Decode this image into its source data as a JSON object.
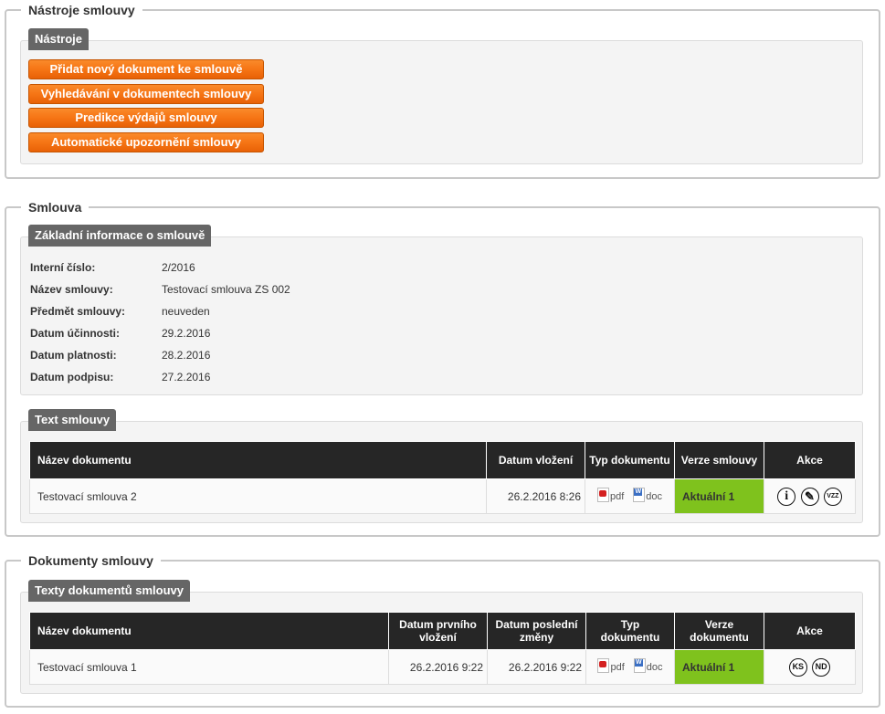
{
  "tools": {
    "legend": "Nástroje smlouvy",
    "panel_title": "Nástroje",
    "buttons": [
      "Přidat nový dokument ke smlouvě",
      "Vyhledávání v dokumentech smlouvy",
      "Predikce výdajů smlouvy",
      "Automatické upozornění smlouvy"
    ]
  },
  "contract": {
    "legend": "Smlouva",
    "basic_title": "Základní informace o smlouvě",
    "fields": [
      {
        "label": "Interní číslo:",
        "value": "2/2016"
      },
      {
        "label": "Název smlouvy:",
        "value": "Testovací smlouva ZS 002"
      },
      {
        "label": "Předmět smlouvy:",
        "value": "neuveden"
      },
      {
        "label": "Datum účinnosti:",
        "value": "29.2.2016"
      },
      {
        "label": "Datum platnosti:",
        "value": "28.2.2016"
      },
      {
        "label": "Datum podpisu:",
        "value": "27.2.2016"
      }
    ],
    "text_title": "Text smlouvy",
    "columns": {
      "name": "Název dokumentu",
      "date": "Datum vložení",
      "type": "Typ dokumentu",
      "version": "Verze smlouvy",
      "actions": "Akce"
    },
    "rows": [
      {
        "name": "Testovací smlouva 2",
        "date": "26.2.2016 8:26",
        "pdf": "pdf",
        "doc": "doc",
        "version": "Aktuální 1",
        "actions": [
          "i",
          "✎",
          "VZZ"
        ]
      }
    ]
  },
  "documents": {
    "legend": "Dokumenty smlouvy",
    "panel_title": "Texty dokumentů smlouvy",
    "columns": {
      "name": "Název dokumentu",
      "first_date": "Datum prvního vložení",
      "last_date": "Datum poslední změny",
      "type": "Typ dokumentu",
      "version": "Verze dokumentu",
      "actions": "Akce"
    },
    "rows": [
      {
        "name": "Testovací smlouva 1",
        "first_date": "26.2.2016 9:22",
        "last_date": "26.2.2016 9:22",
        "pdf": "pdf",
        "doc": "doc",
        "version": "Aktuální 1",
        "actions": [
          "KS",
          "ND"
        ]
      }
    ]
  },
  "colors": {
    "accent_orange": "#f67515",
    "header_dark": "#262626",
    "status_green": "#7fc21d",
    "tag_gray": "#666666"
  },
  "icons": [
    "pdf-file-icon",
    "word-doc-icon",
    "info-icon",
    "edit-pencil-icon"
  ]
}
